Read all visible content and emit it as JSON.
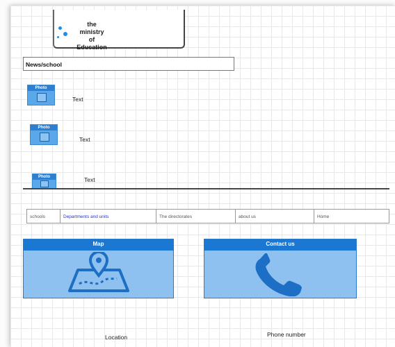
{
  "header": {
    "logo_text": "the\nministry\nof\nEducation"
  },
  "news": {
    "heading": "News/school",
    "items": [
      {
        "photo_label": "Photo",
        "text": "Text"
      },
      {
        "photo_label": "Photo",
        "text": "Text"
      },
      {
        "photo_label": "Photo",
        "text": "Text"
      }
    ]
  },
  "nav": {
    "items": [
      {
        "label": "schools"
      },
      {
        "label": "Departments and units"
      },
      {
        "label": "The directorates"
      },
      {
        "label": "about us"
      },
      {
        "label": "Home"
      }
    ]
  },
  "cards": {
    "map": {
      "title": "Map",
      "caption": "Location",
      "icon": "map-pin-icon"
    },
    "contact": {
      "title": "Contact us",
      "caption": "Phone number",
      "icon": "phone-icon"
    }
  },
  "colors": {
    "accent": "#1a78d2",
    "card_fill": "#8ec1f0",
    "active_link": "#2233cc"
  }
}
